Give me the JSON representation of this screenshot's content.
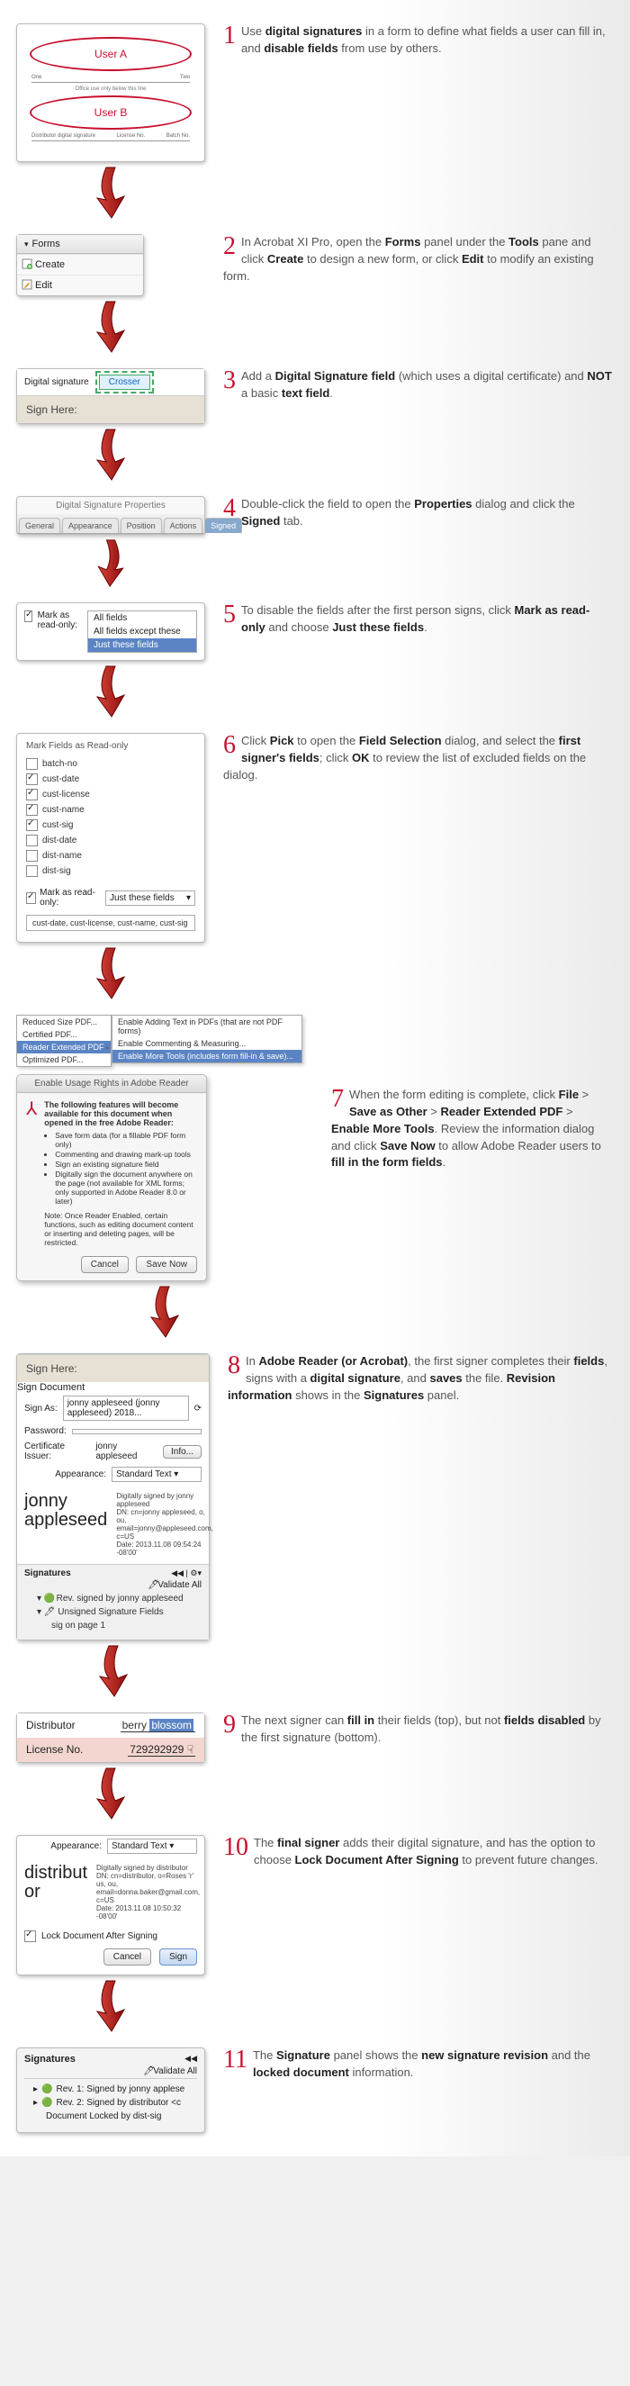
{
  "steps": [
    {
      "n": "1",
      "text_pre": "Use ",
      "b1": "digital signatures",
      "mid1": " in a form to define what fields a user can fill in, and ",
      "b2": "disable fields",
      "post": " from use by others."
    },
    {
      "n": "2",
      "text": "In Acrobat XI Pro, open the ",
      "b1": "Forms",
      "mid1": " panel under the ",
      "b2": "Tools",
      "mid2": " pane and click ",
      "b3": "Create",
      "mid3": " to design a new form, or click ",
      "b4": "Edit",
      "post": " to modify an existing form."
    },
    {
      "n": "3",
      "text": "Add a ",
      "b1": "Digital Signature field",
      "mid1": " (which uses a digital certificate) and ",
      "b2": "NOT",
      "mid2": " a basic ",
      "b3": "text field",
      "post": "."
    },
    {
      "n": "4",
      "text": "Double-click the field to open the ",
      "b1": "Properties",
      "mid1": " dialog and click the ",
      "b2": "Signed",
      "post": " tab."
    },
    {
      "n": "5",
      "text": "To disable the fields after the first person signs, click ",
      "b1": "Mark as read-only",
      "mid1": " and choose ",
      "b2": "Just these fields",
      "post": "."
    },
    {
      "n": "6",
      "text": "Click ",
      "b1": "Pick",
      "mid1": " to open the ",
      "b2": "Field Selection",
      "mid2": " dialog, and select the ",
      "b3": "first signer's fields",
      "mid3": "; click ",
      "b4": "OK",
      "post": " to review the list of excluded fields on the dialog."
    },
    {
      "n": "7",
      "text": "When the form editing is complete, click ",
      "b1": "File",
      "mid1": " > ",
      "b2": "Save as Other",
      "mid2": " > ",
      "b3": "Reader Extended PDF",
      "mid3": " > ",
      "b4": "Enable More Tools",
      "mid4": ". Review the information dialog and click ",
      "b5": "Save Now",
      "post": " to allow Adobe Reader users to ",
      "b6": "fill in the form fields",
      "post2": "."
    },
    {
      "n": "8",
      "text": "In ",
      "b1": "Adobe Reader (or Acrobat)",
      "mid1": ", the first signer completes their ",
      "b2": "fields",
      "mid2": ", signs with a ",
      "b3": "digital signature",
      "mid3": ", and ",
      "b4": "saves",
      "mid4": " the file. ",
      "b5": "Revision information",
      "mid5": " shows in the ",
      "b6": "Signatures",
      "post": " panel."
    },
    {
      "n": "9",
      "text": "The next signer can ",
      "b1": "fill in",
      "mid1": " their fields (top), but not ",
      "b2": "fields disabled",
      "post": " by the first signature (bottom)."
    },
    {
      "n": "10",
      "text": "The ",
      "b1": "final signer",
      "mid1": " adds their digital signature, and has the option to choose ",
      "b2": "Lock Document After Signing",
      "post": " to prevent future changes."
    },
    {
      "n": "11",
      "text": "The ",
      "b1": "Signature",
      "mid1": " panel shows the ",
      "b2": "new signature revision",
      "mid2": " and the ",
      "b3": "locked document",
      "post": " information."
    }
  ],
  "s1": {
    "userA": "User A",
    "userB": "User B",
    "one": "One",
    "two": "Two"
  },
  "s2": {
    "title": "Forms",
    "create": "Create",
    "edit": "Edit"
  },
  "s3": {
    "label": "Digital signature",
    "cursor": "Crosser",
    "sign_here": "Sign Here:"
  },
  "s4": {
    "title": "Digital Signature Properties",
    "tabs": [
      "General",
      "Appearance",
      "Position",
      "Actions",
      "Signed"
    ]
  },
  "s5": {
    "label": "Mark as read-only:",
    "opts": [
      "All fields",
      "All fields except these",
      "Just these fields"
    ]
  },
  "s6": {
    "title": "Mark Fields as Read-only",
    "items": [
      {
        "c": false,
        "t": "batch-no"
      },
      {
        "c": true,
        "t": "cust-date"
      },
      {
        "c": true,
        "t": "cust-license"
      },
      {
        "c": true,
        "t": "cust-name"
      },
      {
        "c": true,
        "t": "cust-sig"
      },
      {
        "c": false,
        "t": "dist-date"
      },
      {
        "c": false,
        "t": "dist-name"
      },
      {
        "c": false,
        "t": "dist-sig"
      }
    ],
    "ro_label": "Mark as read-only:",
    "ro_sel": "Just these fields",
    "summary": "cust-date, cust-license, cust-name, cust-sig"
  },
  "s7": {
    "menu": [
      "Reduced Size PDF...",
      "Certified PDF...",
      "Reader Extended PDF",
      "Optimized PDF..."
    ],
    "submenu": [
      "Enable Adding Text in PDFs (that are not PDF forms)",
      "Enable Commenting & Measuring...",
      "Enable More Tools (includes form fill-in & save)..."
    ],
    "dlg_title": "Enable Usage Rights in Adobe Reader",
    "lead": "The following features will become available for this document when opened in the free Adobe Reader:",
    "bullets": [
      "Save form data (for a fillable PDF form only)",
      "Commenting and drawing mark-up tools",
      "Sign an existing signature field",
      "Digitally sign the document anywhere on the page (not available for XML forms; only supported in Adobe Reader 8.0 or later)"
    ],
    "note": "Note: Once Reader Enabled, certain functions, such as editing document content or inserting and deleting pages, will be restricted.",
    "cancel": "Cancel",
    "save": "Save Now"
  },
  "s8": {
    "sign_here": "Sign Here:",
    "dlg_title": "Sign Document",
    "sign_as_l": "Sign As:",
    "sign_as_v": "jonny appleseed (jonny appleseed) 2018...",
    "pw_l": "Password:",
    "issuer_l": "Certificate Issuer:",
    "issuer_v": "jonny appleseed",
    "info": "Info...",
    "appearance_l": "Appearance:",
    "appearance_v": "Standard Text",
    "sig_name": "jonny appleseed",
    "sig_meta": "Digitally signed by jonny appleseed\nDN: cn=jonny appleseed, o, ou,\nemail=jonny@appleseed.com, c=US\nDate: 2013.11.08 09:54:24 -08'00'",
    "panel_title": "Signatures",
    "validate": "Validate All",
    "tree": [
      "Rev. signed by jonny appleseed",
      "Unsigned Signature Fields",
      "sig on page 1"
    ]
  },
  "s9": {
    "dist": "Distributor",
    "dist_v": "berry blossom",
    "lic": "License No.",
    "lic_v": "729292929"
  },
  "s10": {
    "appearance_l": "Appearance:",
    "appearance_v": "Standard Text",
    "sig_name": "distributor",
    "sig_meta": "Digitally signed by distributor\nDN: cn=distributor, o=Roses 'r' us, ou,\nemail=donna.baker@gmail.com, c=US\nDate: 2013.11.08 10:50:32 -08'00'",
    "lock": "Lock Document After Signing",
    "cancel": "Cancel",
    "sign": "Sign"
  },
  "s11": {
    "panel": "Signatures",
    "validate": "Validate All",
    "rows": [
      "Rev. 1: Signed by jonny applese",
      "Rev. 2: Signed by distributor <c",
      "Document Locked by dist-sig"
    ]
  }
}
